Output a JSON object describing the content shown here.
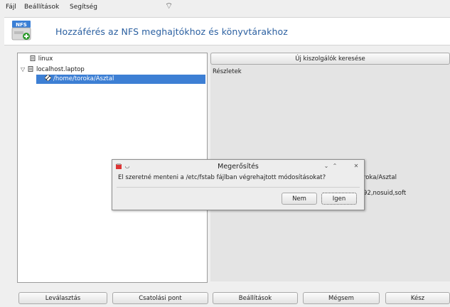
{
  "menubar": {
    "items": [
      "Fájl",
      "Beállítások",
      "Segítség"
    ]
  },
  "banner": {
    "icon_label": "NFS",
    "title": "Hozzáférés az NFS meghajtókhoz és könyvtárakhoz"
  },
  "tree": {
    "items": [
      {
        "label": "linux",
        "icon": "server-icon"
      },
      {
        "label": "localhost.laptop",
        "icon": "server-icon",
        "expanded": true
      },
      {
        "label": "/home/toroka/Asztal",
        "icon": "nfs-share-icon",
        "selected": true
      }
    ]
  },
  "right": {
    "search_button": "Új kiszolgálók keresése",
    "details_label": "Részletek",
    "detail_line1": "roka/Asztal",
    "detail_line2": "92,nosuid,soft"
  },
  "dialog": {
    "title": "Megerősítés",
    "message": "El szeretné menteni a /etc/fstab fájlban végrehajtott módosításokat?",
    "no_button": "Nem",
    "yes_button": "Igen"
  },
  "bottom_buttons": [
    "Leválasztás",
    "Csatolási pont",
    "Beállítások",
    "Mégsem",
    "Kész"
  ],
  "colors": {
    "accent": "#2a5fa0",
    "selection": "#3d7fd4"
  }
}
